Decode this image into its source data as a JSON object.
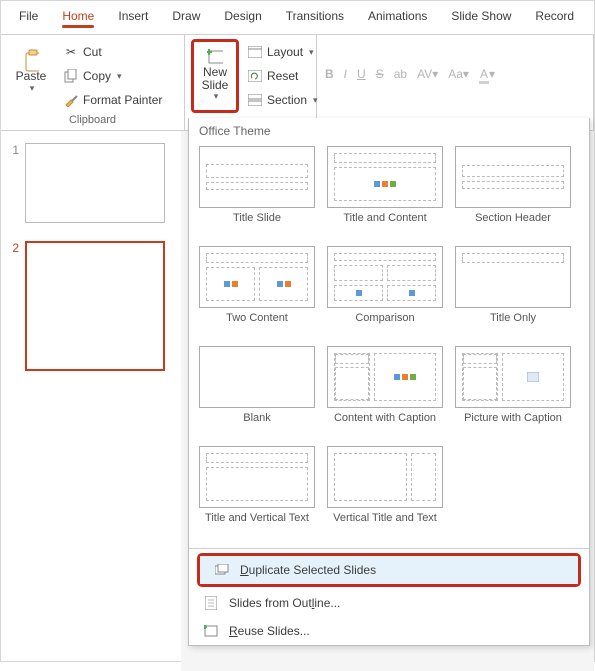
{
  "tabs": [
    "File",
    "Home",
    "Insert",
    "Draw",
    "Design",
    "Transitions",
    "Animations",
    "Slide Show",
    "Record"
  ],
  "activeTab": "Home",
  "clipboard": {
    "paste": "Paste",
    "cut": "Cut",
    "copy": "Copy",
    "fmtPainter": "Format Painter",
    "groupLabel": "Clipboard"
  },
  "slides": {
    "newSlide": "New\nSlide",
    "layout": "Layout",
    "reset": "Reset",
    "section": "Section"
  },
  "font": {
    "b": "B",
    "i": "I",
    "u": "U",
    "s": "S",
    "ab": "ab",
    "av": "AV",
    "aa": "Aa",
    "a": "A"
  },
  "thumbs": [
    {
      "n": "1"
    },
    {
      "n": "2"
    }
  ],
  "dd": {
    "title": "Office Theme",
    "layouts": [
      "Title Slide",
      "Title and Content",
      "Section Header",
      "Two Content",
      "Comparison",
      "Title Only",
      "Blank",
      "Content with Caption",
      "Picture with Caption",
      "Title and Vertical Text",
      "Vertical Title and Text"
    ],
    "dup": "Duplicate Selected Slides",
    "outline": "Slides from Outline...",
    "reuse": "Reuse Slides..."
  }
}
